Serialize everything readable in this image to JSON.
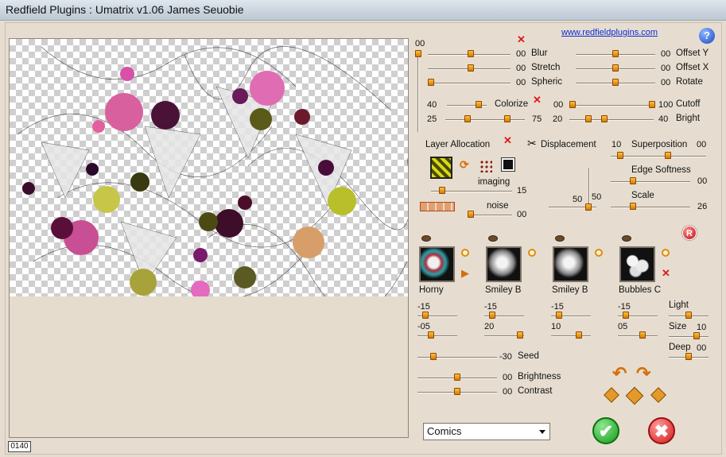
{
  "window": {
    "title": "Redfield Plugins : Umatrix v1.06   James Seuobie"
  },
  "header": {
    "link": "www.redfieldplugins.com",
    "help": "?"
  },
  "status": {
    "counter": "0140"
  },
  "top_slider_value": "00",
  "left_sliders": [
    {
      "value": "00",
      "label": "Blur"
    },
    {
      "value": "00",
      "label": "Stretch"
    },
    {
      "value": "00",
      "label": "Spheric"
    }
  ],
  "right_sliders": [
    {
      "value": "00",
      "label": "Offset Y"
    },
    {
      "value": "00",
      "label": "Offset X"
    },
    {
      "value": "00",
      "label": "Rotate"
    }
  ],
  "colorize": {
    "left": "40",
    "label": "Colorize",
    "right": "00"
  },
  "cutoff": {
    "value": "100",
    "label": "Cutoff"
  },
  "range_row": {
    "a": "25",
    "b": "75",
    "c": "20",
    "d": "40",
    "label": "Bright"
  },
  "layer": {
    "label": "Layer Allocation",
    "imaging_label": "imaging",
    "imaging_value": "15",
    "noise_label": "noise",
    "noise_value": "00"
  },
  "displacement": {
    "label": "Displacement",
    "v1": "50",
    "v2": "50"
  },
  "superposition": {
    "left": "10",
    "label": "Superposition",
    "right": "00"
  },
  "edge": {
    "label": "Edge Softness",
    "value": "00"
  },
  "scale": {
    "label": "Scale",
    "value": "26"
  },
  "tiles": [
    {
      "name": "Horny",
      "v1": "-15",
      "v2": "-05"
    },
    {
      "name": "Smiley B",
      "v1": "-15",
      "v2": "20"
    },
    {
      "name": "Smiley B",
      "v1": "-15",
      "v2": "10"
    },
    {
      "name": "Bubbles C",
      "v1": "-15",
      "v2": "05"
    }
  ],
  "light": {
    "label": "Light"
  },
  "size": {
    "label": "Size",
    "value": "10"
  },
  "deep": {
    "label": "Deep",
    "value": "00"
  },
  "seed": {
    "value": "-30",
    "label": "Seed"
  },
  "brightness": {
    "value": "00",
    "label": "Brightness"
  },
  "contrast": {
    "value": "00",
    "label": "Contrast"
  },
  "reset_button": "R",
  "preset": {
    "selected": "Comics"
  },
  "buttons": {
    "ok": "✔",
    "cancel": "✖"
  },
  "accent_color": "#e08a10"
}
